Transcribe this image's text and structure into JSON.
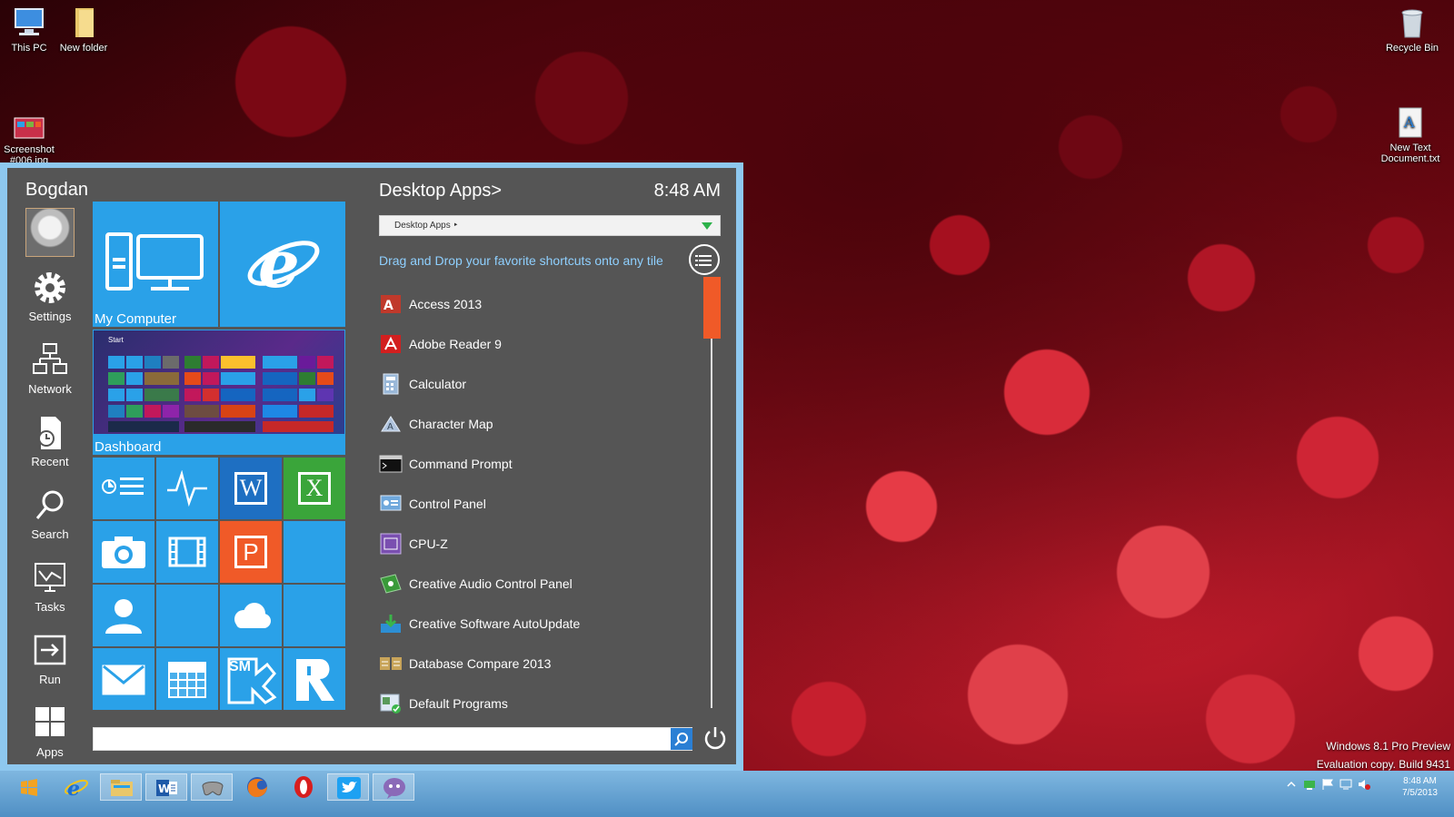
{
  "desktop": {
    "icons": [
      {
        "label": "This PC"
      },
      {
        "label": "New folder"
      },
      {
        "label": "Screenshot\n#006.jpg"
      },
      {
        "label": "Recycle Bin"
      },
      {
        "label": "New Text\nDocument.txt"
      }
    ]
  },
  "start_menu": {
    "user_name": "Bogdan",
    "sidebar": [
      {
        "label": "Settings",
        "icon": "gear-icon"
      },
      {
        "label": "Network",
        "icon": "network-icon"
      },
      {
        "label": "Recent",
        "icon": "recent-icon"
      },
      {
        "label": "Search",
        "icon": "search-icon"
      },
      {
        "label": "Tasks",
        "icon": "tasks-icon"
      },
      {
        "label": "Run",
        "icon": "run-icon"
      },
      {
        "label": "Apps",
        "icon": "apps-icon"
      }
    ],
    "tiles": {
      "my_computer": "My Computer",
      "dashboard": "Dashboard",
      "dashboard_preview_title": "Start",
      "word_letter": "W",
      "excel_letter": "X",
      "powerpoint_letter": "P",
      "sm_label": "SM"
    },
    "apps_header": "Desktop Apps>",
    "clock": "8:48 AM",
    "dropdown_value": "Desktop Apps ‣",
    "hint": "Drag and Drop your favorite shortcuts onto any tile",
    "apps": [
      {
        "label": "Access 2013",
        "icon": "access-icon",
        "color": "#c0392b"
      },
      {
        "label": "Adobe Reader 9",
        "icon": "adobe-reader-icon",
        "color": "#d21f1f"
      },
      {
        "label": "Calculator",
        "icon": "calculator-icon",
        "color": "#9ab8d8"
      },
      {
        "label": "Character Map",
        "icon": "character-map-icon",
        "color": "#b0c4de"
      },
      {
        "label": "Command Prompt",
        "icon": "command-prompt-icon",
        "color": "#111111"
      },
      {
        "label": "Control Panel",
        "icon": "control-panel-icon",
        "color": "#6fa8dc"
      },
      {
        "label": "CPU-Z",
        "icon": "cpu-z-icon",
        "color": "#7a4fb0"
      },
      {
        "label": "Creative Audio Control Panel",
        "icon": "creative-audio-icon",
        "color": "#3a9a3a"
      },
      {
        "label": "Creative Software AutoUpdate",
        "icon": "creative-update-icon",
        "color": "#2d8fd4"
      },
      {
        "label": "Database Compare 2013",
        "icon": "database-compare-icon",
        "color": "#c8a45a"
      },
      {
        "label": "Default Programs",
        "icon": "default-programs-icon",
        "color": "#5a9a5a"
      }
    ],
    "search_value": ""
  },
  "watermark": {
    "line1": "Windows 8.1 Pro Preview",
    "line2": "Evaluation copy. Build 9431"
  },
  "taskbar": {
    "items": [
      "start-button",
      "internet-explorer",
      "file-explorer",
      "word",
      "game",
      "firefox",
      "opera",
      "twitter",
      "chat"
    ],
    "tray_time": "8:48 AM",
    "tray_date": "7/5/2013"
  },
  "colors": {
    "tile_blue": "#2aa1e8",
    "tile_dark_blue": "#1e6fc2",
    "excel_green": "#3aa53a",
    "powerpoint_orange": "#f05a28",
    "menu_bg": "#555555",
    "frame_blue": "#8ec8ef",
    "hint_text": "#8fd0ff"
  }
}
